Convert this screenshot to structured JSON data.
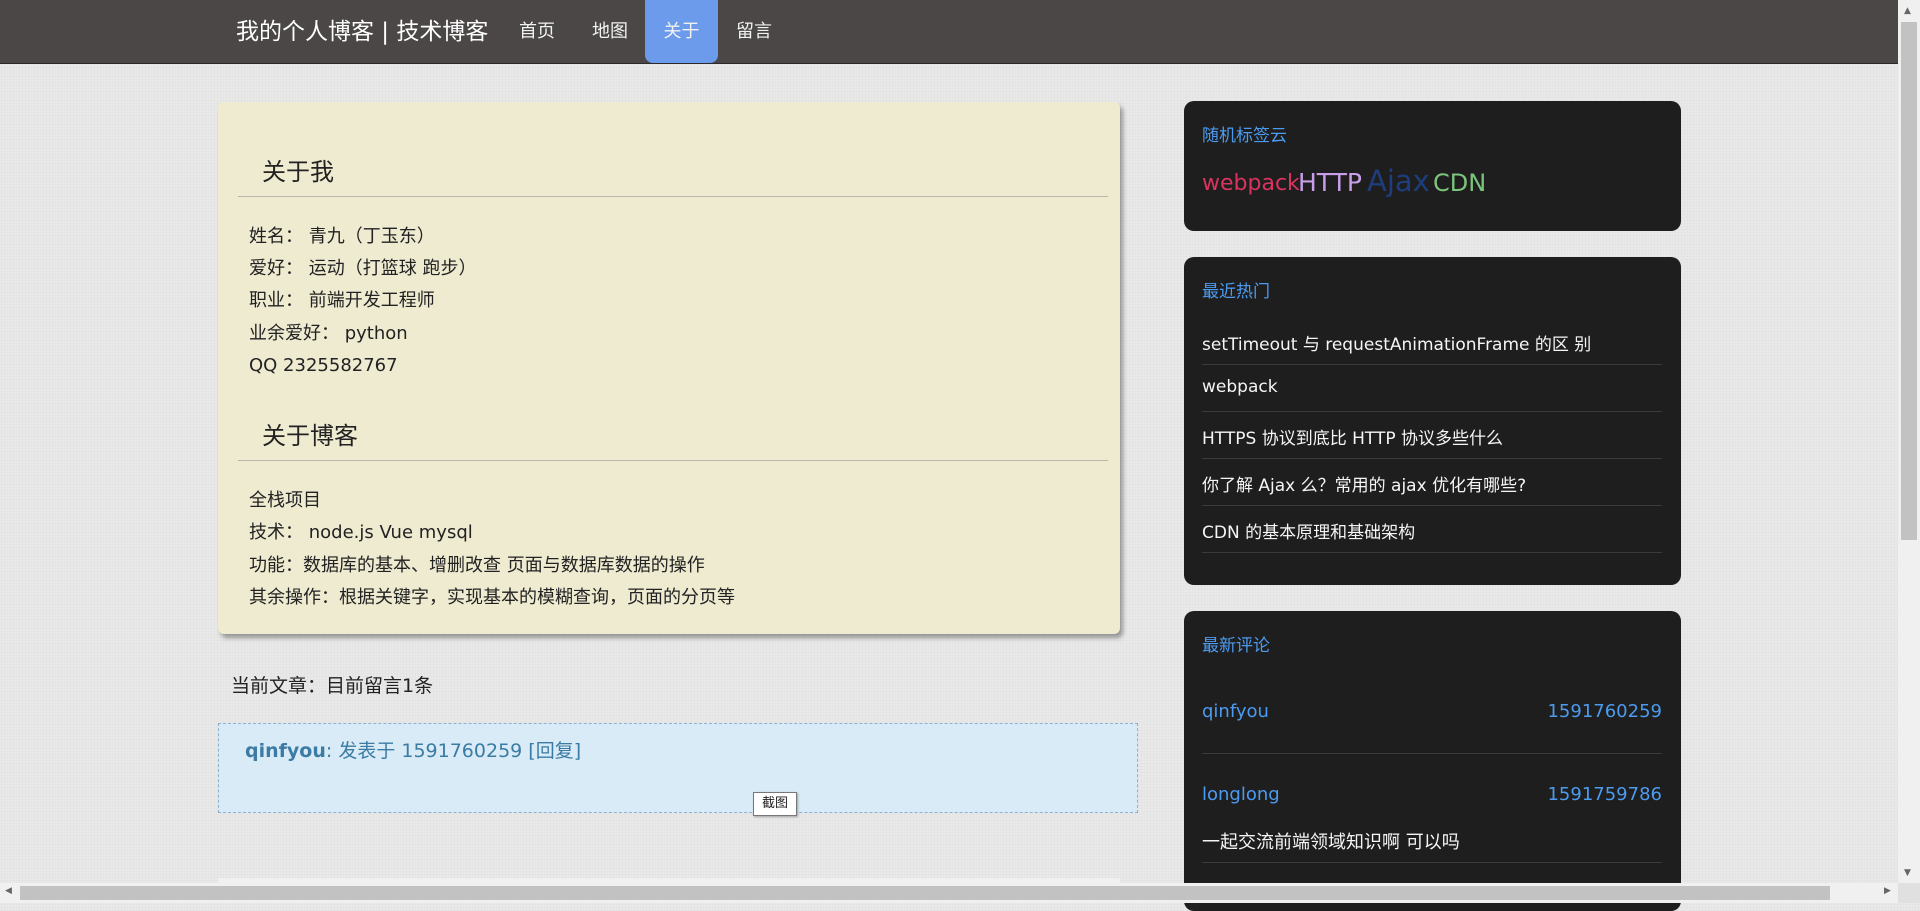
{
  "nav": {
    "brand": "我的个人博客 | 技术博客",
    "items": [
      {
        "label": "首页",
        "active": false
      },
      {
        "label": "地图",
        "active": false
      },
      {
        "label": "关于",
        "active": true
      },
      {
        "label": "留言",
        "active": false
      }
    ]
  },
  "about": {
    "me_title": "关于我",
    "me_lines": [
      "姓名： 青九（丁玉东）",
      "爱好： 运动（打篮球 跑步）",
      "职业： 前端开发工程师",
      "业余爱好： python",
      "QQ 2325582767"
    ],
    "blog_title": "关于博客",
    "blog_lines": [
      "全栈项目",
      "技术： node.js Vue mysql",
      "功能：数据库的基本、增删改查 页面与数据库数据的操作",
      "其余操作：根据关键字，实现基本的模糊查询，页面的分页等"
    ]
  },
  "comments": {
    "count_text": "当前文章：目前留言1条",
    "items": [
      {
        "author": "qinfyou",
        "meta": ": 发表于 1591760259 [回复]"
      }
    ]
  },
  "tooltip": "截图",
  "sidebar": {
    "tag_cloud": {
      "title": "随机标签云",
      "tags": [
        {
          "label": "webpack",
          "color": "#d8345f"
        },
        {
          "label": "HTTP",
          "color": "#c89ee8"
        },
        {
          "label": "Ajax",
          "color": "#1e3d7c"
        },
        {
          "label": "CDN",
          "color": "#7cc47c"
        }
      ]
    },
    "hot": {
      "title": "最近热门",
      "items": [
        "setTimeout 与 requestAnimationFrame 的区 别",
        "webpack",
        "HTTPS 协议到底比 HTTP 协议多些什么",
        "你了解 Ajax 么？常用的 ajax 优化有哪些?",
        "CDN 的基本原理和基础架构"
      ]
    },
    "latest": {
      "title": "最新评论",
      "items": [
        {
          "name": "qinfyou",
          "time": "1591760259",
          "text": ""
        },
        {
          "name": "longlong",
          "time": "1591759786",
          "text": "一起交流前端领域知识啊 可以吗"
        }
      ]
    }
  },
  "icons": {
    "scroll_up": "up-arrow-icon",
    "scroll_down": "down-arrow-icon",
    "scroll_left": "left-arrow-icon",
    "scroll_right": "right-arrow-icon"
  }
}
